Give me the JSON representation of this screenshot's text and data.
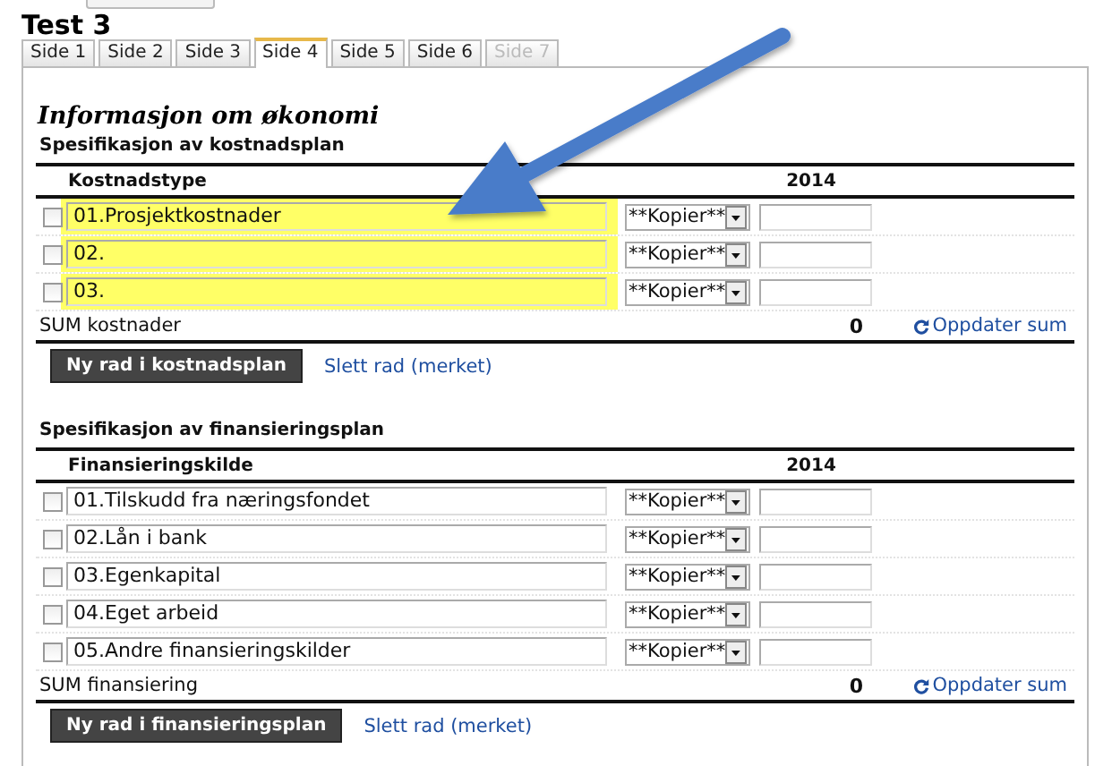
{
  "page": {
    "title": "Test 3"
  },
  "tabs": [
    {
      "label": "Side 1",
      "selected": false,
      "disabled": false
    },
    {
      "label": "Side 2",
      "selected": false,
      "disabled": false
    },
    {
      "label": "Side 3",
      "selected": false,
      "disabled": false
    },
    {
      "label": "Side 4",
      "selected": true,
      "disabled": false
    },
    {
      "label": "Side 5",
      "selected": false,
      "disabled": false
    },
    {
      "label": "Side 6",
      "selected": false,
      "disabled": false
    },
    {
      "label": "Side 7",
      "selected": false,
      "disabled": true
    }
  ],
  "heading": "Informasjon om økonomi",
  "sections": [
    {
      "title": "Spesifikasjon av kostnadsplan",
      "column_label": "Kostnadstype",
      "column_year": "2014",
      "rows": [
        {
          "checked": false,
          "label": "01.Prosjektkostnader",
          "copy": "**Kopier**",
          "highlighted": true
        },
        {
          "checked": false,
          "label": "02.",
          "copy": "**Kopier**",
          "highlighted": true
        },
        {
          "checked": false,
          "label": "03.",
          "copy": "**Kopier**",
          "highlighted": true
        }
      ],
      "sum_label": "SUM kostnader",
      "sum": "0",
      "update_link": "Oppdater sum",
      "add_button": "Ny rad i kostnadsplan",
      "delete_link": "Slett rad (merket)"
    },
    {
      "title": "Spesifikasjon av finansieringsplan",
      "column_label": "Finansieringskilde",
      "column_year": "2014",
      "rows": [
        {
          "checked": false,
          "label": "01.Tilskudd fra næringsfondet",
          "copy": "**Kopier**",
          "highlighted": false
        },
        {
          "checked": false,
          "label": "02.Lån i bank",
          "copy": "**Kopier**",
          "highlighted": false
        },
        {
          "checked": false,
          "label": "03.Egenkapital",
          "copy": "**Kopier**",
          "highlighted": false
        },
        {
          "checked": false,
          "label": "04.Eget arbeid",
          "copy": "**Kopier**",
          "highlighted": false
        },
        {
          "checked": false,
          "label": "05.Andre finansieringskilder",
          "copy": "**Kopier**",
          "highlighted": false
        }
      ],
      "sum_label": "SUM finansiering",
      "sum": "0",
      "update_link": "Oppdater sum",
      "add_button": "Ny rad i finansieringsplan",
      "delete_link": "Slett rad (merket)"
    }
  ]
}
